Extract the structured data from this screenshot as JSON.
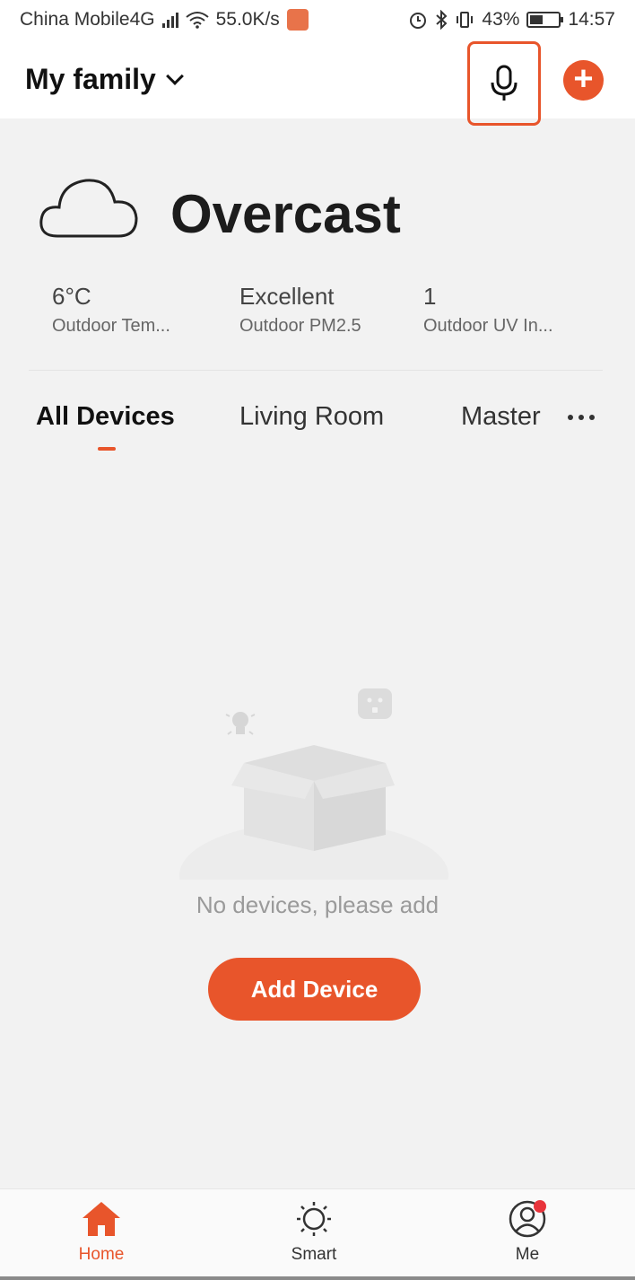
{
  "status_bar": {
    "carrier": "China Mobile4G",
    "speed": "55.0K/s",
    "battery": "43%",
    "time": "14:57"
  },
  "header": {
    "family_name": "My family"
  },
  "weather": {
    "condition": "Overcast",
    "stats": [
      {
        "value": "6°C",
        "label": "Outdoor Tem..."
      },
      {
        "value": "Excellent",
        "label": "Outdoor PM2.5"
      },
      {
        "value": "1",
        "label": "Outdoor UV In..."
      }
    ]
  },
  "tabs": [
    {
      "label": "All Devices",
      "active": true
    },
    {
      "label": "Living Room",
      "active": false
    },
    {
      "label": "Master",
      "active": false
    }
  ],
  "empty_state": {
    "message": "No devices, please add",
    "button_label": "Add Device"
  },
  "bottom_nav": [
    {
      "label": "Home",
      "icon": "home-icon",
      "active": true
    },
    {
      "label": "Smart",
      "icon": "sun-icon",
      "active": false
    },
    {
      "label": "Me",
      "icon": "profile-icon",
      "active": false,
      "badge": true
    }
  ],
  "colors": {
    "accent": "#e8552b",
    "background": "#f2f2f2"
  }
}
